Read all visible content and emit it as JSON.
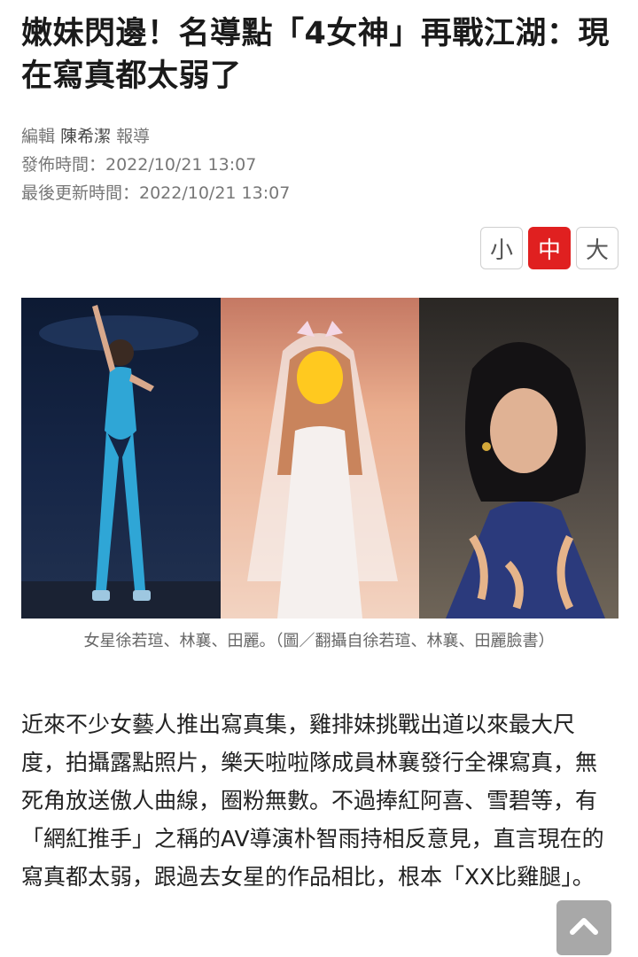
{
  "article": {
    "title": "嫩妹閃邊！名導點「4女神」再戰江湖：現在寫真都太弱了",
    "editor_label": "編輯",
    "author": "陳希潔",
    "report_label": "報導",
    "published": "發佈時間：2022/10/21 13:07",
    "updated": "最後更新時間：2022/10/21 13:07"
  },
  "font_size": {
    "small": "小",
    "medium": "中",
    "large": "大",
    "selected": "中",
    "active_color": "#e02020"
  },
  "photo": {
    "caption": "女星徐若瑄、林襄、田麗。（圖／翻攝自徐若瑄、林襄、田麗臉書）"
  },
  "body": {
    "paragraph": "近來不少女藝人推出寫真集，雞排妹挑戰出道以來最大尺度，拍攝露點照片，樂天啦啦隊成員林襄發行全裸寫真，無死角放送傲人曲線，圈粉無數。不過捧紅阿喜、雪碧等，有「網紅推手」之稱的AV導演朴智雨持相反意見，直言現在的寫真都太弱，跟過去女星的作品相比，根本「XX比雞腿」。"
  },
  "scroll_top": {
    "icon": "chevron-up-icon"
  }
}
